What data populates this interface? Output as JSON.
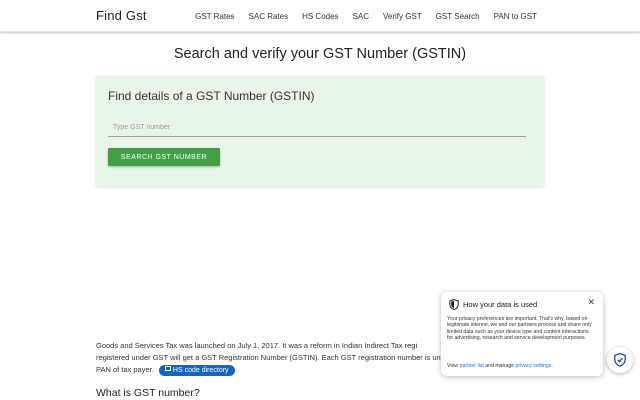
{
  "navbar": {
    "brand": "Find Gst",
    "links": [
      "GST Rates",
      "SAC Rates",
      "HS Codes",
      "SAC",
      "Verify GST",
      "GST Search",
      "PAN to GST"
    ]
  },
  "main": {
    "title": "Search and verify your GST Number (GSTIN)",
    "card": {
      "title": "Find details of a GST Number (GSTIN)",
      "input_value": "",
      "input_placeholder": "Type GST number",
      "button_label": "SEARCH GST NUMBER"
    },
    "intro": {
      "line1": "Goods and Services Tax was launched on July 1, 2017. It was a reform in Indian Indirect Tax regi",
      "line2": "registered under GST will get a GST Registration Number (GSTIN). Each GST registration number is un",
      "line3": "PAN of tax payer.",
      "chip_label": "HS code directory"
    },
    "section_heading": "What is GST number?"
  },
  "privacy_popup": {
    "title": "How your data is used",
    "close": "✕",
    "text": "Your privacy preferences are important. That's why, based on legitimate interest, we and our partners process and share only limited data such as your device type and content interactions for advertising, research and service development purposes.",
    "links_prefix": "View ",
    "partner_link": "partner list",
    "links_middle": " and manage ",
    "settings_link": "privacy settings",
    "links_suffix": "."
  },
  "colors": {
    "accent_green": "#43a047",
    "card_bg": "#e8f5e9",
    "chip_blue": "#1565c0",
    "link_blue": "#1a73e8"
  }
}
